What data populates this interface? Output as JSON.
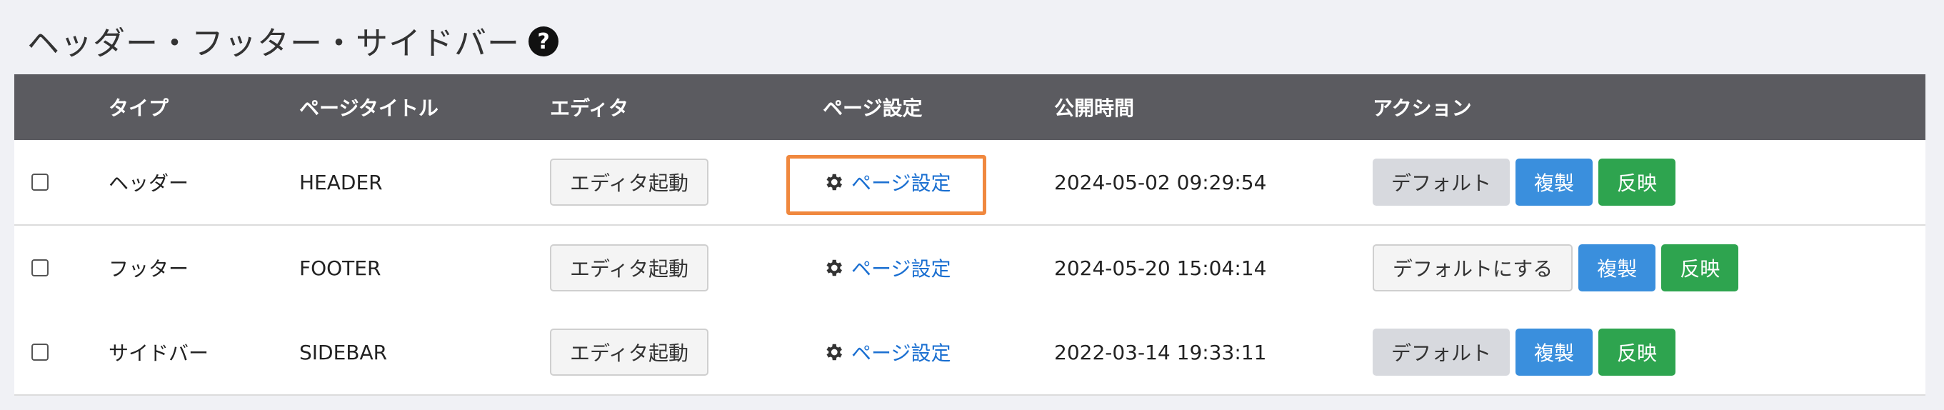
{
  "page": {
    "title": "ヘッダー・フッター・サイドバー"
  },
  "table": {
    "columns": [
      "",
      "タイプ",
      "ページタイトル",
      "エディタ",
      "ページ設定",
      "公開時間",
      "アクション"
    ],
    "rows": [
      {
        "type": "ヘッダー",
        "page_title": "HEADER",
        "editor_label": "エディタ起動",
        "settings_label": "ページ設定",
        "published": "2024-05-02 09:29:54",
        "actions": [
          "デフォルト",
          "複製",
          "反映"
        ],
        "highlighted": true
      },
      {
        "type": "フッター",
        "page_title": "FOOTER",
        "editor_label": "エディタ起動",
        "settings_label": "ページ設定",
        "published": "2024-05-20 15:04:14",
        "actions": [
          "デフォルトにする",
          "複製",
          "反映"
        ],
        "highlighted": false
      },
      {
        "type": "サイドバー",
        "page_title": "SIDEBAR",
        "editor_label": "エディタ起動",
        "settings_label": "ページ設定",
        "published": "2022-03-14 19:33:11",
        "actions": [
          "デフォルト",
          "複製",
          "反映"
        ],
        "highlighted": false
      }
    ]
  },
  "colors": {
    "header_bg": "#5b5b60",
    "link": "#1a6fd1",
    "copy_button": "#3a8fdd",
    "apply_button": "#2ea44f",
    "highlight": "#f0883e"
  },
  "icons": {
    "help": "question-circle-icon",
    "settings": "gear-icon"
  }
}
